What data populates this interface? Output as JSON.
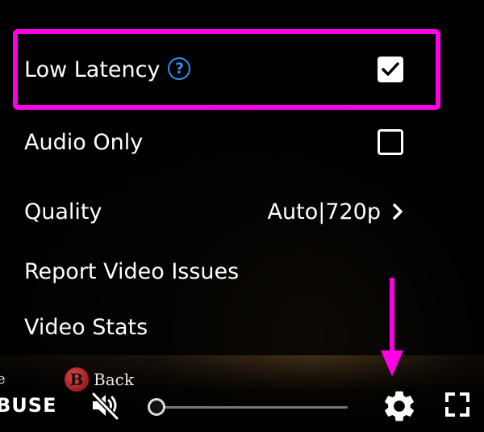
{
  "menu": {
    "low_latency": {
      "label": "Low Latency",
      "checked": true
    },
    "audio_only": {
      "label": "Audio Only",
      "checked": false
    },
    "quality": {
      "label": "Quality",
      "value": "Auto|720p"
    },
    "report_video_issues": {
      "label": "Report Video Issues"
    },
    "video_stats": {
      "label": "Video Stats"
    }
  },
  "game_overlay": {
    "left_text": "e",
    "button_letter": "B",
    "button_text": "Back"
  },
  "controls": {
    "report_label": "BUSE",
    "volume_level": 0,
    "muted": true
  },
  "icons": {
    "help": "help-icon",
    "check": "check-icon",
    "chevron": "chevron-right-icon",
    "mute": "volume-muted-icon",
    "settings": "gear-icon",
    "fullscreen": "fullscreen-icon"
  },
  "colors": {
    "highlight": "#ff00e6",
    "help_icon": "#2f8ff0",
    "text": "#ffffff",
    "background": "#000000"
  }
}
